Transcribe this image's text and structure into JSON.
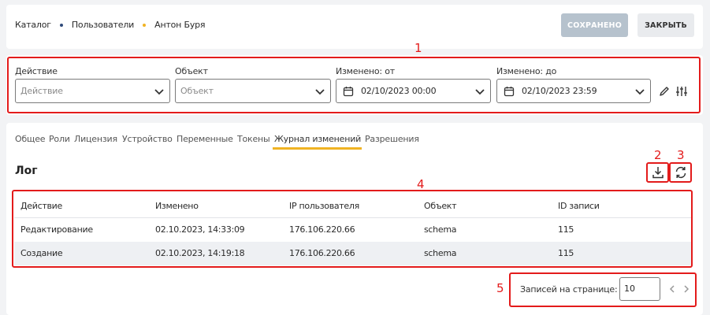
{
  "breadcrumb": {
    "items": [
      "Каталог",
      "Пользователи",
      "Антон Буря"
    ],
    "dot_colors": [
      "#2f4a7a",
      "#f0b323"
    ]
  },
  "header": {
    "saved_label": "СОХРАНЕНО",
    "close_label": "ЗАКРЫТЬ"
  },
  "filters": {
    "action": {
      "label": "Действие",
      "placeholder": "Действие"
    },
    "object": {
      "label": "Объект",
      "placeholder": "Объект"
    },
    "changed_from": {
      "label": "Изменено: от",
      "value": "02/10/2023 00:00"
    },
    "changed_to": {
      "label": "Изменено: до",
      "value": "02/10/2023 23:59"
    }
  },
  "tabs": [
    "Общее",
    "Роли",
    "Лицензия",
    "Устройство",
    "Переменные",
    "Токены",
    "Журнал изменений",
    "Разрешения"
  ],
  "active_tab": "Журнал изменений",
  "log": {
    "title": "Лог",
    "columns": [
      "Действие",
      "Изменено",
      "IP пользователя",
      "Объект",
      "ID записи"
    ],
    "rows": [
      [
        "Редактирование",
        "02.10.2023, 14:33:09",
        "176.106.220.66",
        "schema",
        "115"
      ],
      [
        "Создание",
        "02.10.2023, 14:19:18",
        "176.106.220.66",
        "schema",
        "115"
      ]
    ]
  },
  "pagination": {
    "per_page_label": "Записей на странице:",
    "per_page_value": "10"
  },
  "annotations": [
    "1",
    "2",
    "3",
    "4",
    "5"
  ],
  "colors": {
    "accent": "#f0b323",
    "annotation": "#e31b1b",
    "saved_button_bg": "#b6c2cd",
    "close_button_bg": "#e9ebee"
  }
}
